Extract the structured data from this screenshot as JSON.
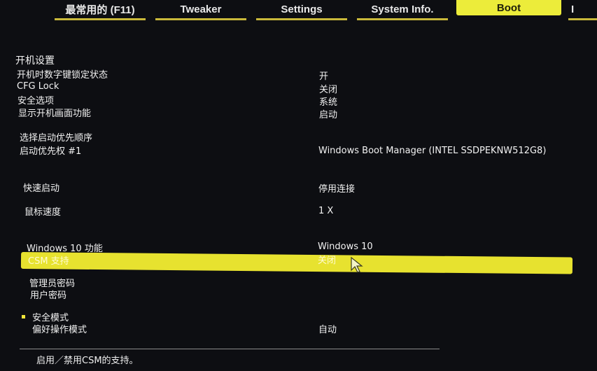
{
  "tabs": [
    {
      "label": "最常用的 (F11)"
    },
    {
      "label": "Tweaker"
    },
    {
      "label": "Settings"
    },
    {
      "label": "System Info."
    },
    {
      "label": "Boot"
    },
    {
      "label": "I"
    }
  ],
  "active_tab": "Boot",
  "settings": {
    "boot_config_header": "开机设置",
    "numlock": {
      "label": "开机时数字键锁定状态",
      "value": "开"
    },
    "cfg_lock": {
      "label": "CFG Lock",
      "value": "关闭"
    },
    "security_option": {
      "label": "安全选项",
      "value": "系统"
    },
    "logo_display": {
      "label": "显示开机画面功能",
      "value": "启动"
    },
    "boot_priority_header": "选择启动优先顺序",
    "boot_option_1": {
      "label": "启动优先权 #1",
      "value": "Windows Boot Manager (INTEL SSDPEKNW512G8)"
    },
    "fast_boot": {
      "label": "快速启动",
      "value": "停用连接"
    },
    "mouse_speed": {
      "label": "鼠标速度",
      "value": "1 X"
    },
    "windows10_features": {
      "label": "Windows 10 功能",
      "value": "Windows 10"
    },
    "csm_support": {
      "label": "CSM 支持",
      "value": "关闭"
    },
    "admin_password": {
      "label": "管理员密码"
    },
    "user_password": {
      "label": "用户密码"
    },
    "secure_boot": {
      "label": "安全模式"
    },
    "preferred_mode": {
      "label": "偏好操作模式",
      "value": "自动"
    }
  },
  "help_text": "启用／禁用CSM的支持。",
  "colors": {
    "highlight": "#e7e22f",
    "active_tab": "#ecec3a",
    "background": "#0d0e12"
  }
}
